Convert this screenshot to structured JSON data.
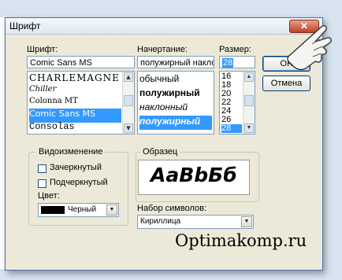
{
  "window": {
    "title": "Шрифт",
    "close_glyph": "✕"
  },
  "font": {
    "label": "Шрифт:",
    "value": "Comic Sans MS",
    "items": [
      {
        "label": "CHARLEMAGNE",
        "selected": false
      },
      {
        "label": "Chiller",
        "selected": false
      },
      {
        "label": "Colonna MT",
        "selected": false
      },
      {
        "label": "Comic Sans MS",
        "selected": true
      },
      {
        "label": "Consolas",
        "selected": false
      }
    ]
  },
  "style": {
    "label": "Начертание:",
    "value": "полужирный наклонный",
    "items": [
      {
        "label": "обычный",
        "selected": false
      },
      {
        "label": "полужирный",
        "selected": false
      },
      {
        "label": "наклонный",
        "selected": false
      },
      {
        "label": "полужирный",
        "selected": true
      }
    ]
  },
  "size": {
    "label": "Размер:",
    "value": "28",
    "items": [
      {
        "label": "16",
        "selected": false
      },
      {
        "label": "18",
        "selected": false
      },
      {
        "label": "20",
        "selected": false
      },
      {
        "label": "22",
        "selected": false
      },
      {
        "label": "24",
        "selected": false
      },
      {
        "label": "26",
        "selected": false
      },
      {
        "label": "28",
        "selected": true
      }
    ]
  },
  "buttons": {
    "ok": "OK",
    "cancel": "Отмена"
  },
  "effects": {
    "group_label": "Видоизменение",
    "strikeout_label": "Зачеркнутый",
    "underline_label": "Подчеркнутый",
    "strikeout_checked": false,
    "underline_checked": false,
    "color_label": "Цвет:",
    "color_value": "Черный",
    "color_hex": "#000000"
  },
  "sample": {
    "group_label": "Образец",
    "text": "AaBbБб"
  },
  "script": {
    "label": "Набор символов:",
    "value": "Кириллица"
  },
  "watermark": "Optimakomp.ru",
  "accent": {
    "selection": "#3399ff",
    "close": "#c0412a"
  }
}
